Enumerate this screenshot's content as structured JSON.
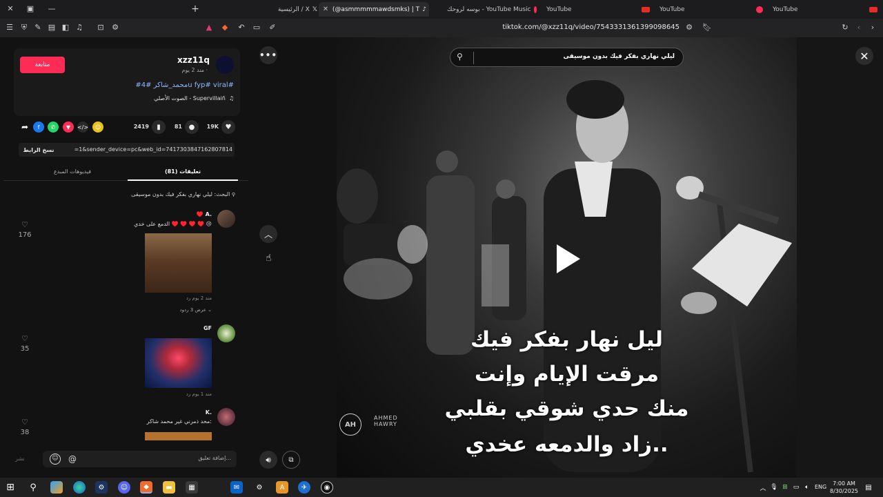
{
  "browser": {
    "tabs": [
      {
        "title": "الرئيسية / X",
        "active": false,
        "icon": "x-logo-icon"
      },
      {
        "title": "(@asmmmmmawdsmks) | TikTok",
        "active": true,
        "icon": "tiktok-icon"
      },
      {
        "title": "بوسه لروحك - YouTube Music",
        "active": false,
        "icon": "youtube-music-icon"
      },
      {
        "title": "YouTube",
        "active": false,
        "icon": "youtube-icon"
      },
      {
        "title": "YouTube",
        "active": false,
        "icon": "youtube-icon"
      },
      {
        "title": "YouTube",
        "active": false,
        "icon": "youtube-icon"
      }
    ],
    "url": "tiktok.com/@xzz11q/video/7543331361399098645"
  },
  "post": {
    "follow_label": "متابعة",
    "username": "xzz11q",
    "time": "مند 2 يوم ·",
    "hashtags": "#محمد_شاكر #4u fyp# viral#",
    "sound": "الصوت الأصلي - Supervillaiñ"
  },
  "stats": {
    "likes": "19K",
    "comments": "81",
    "saves": "2419"
  },
  "share": {
    "copy_label": "نسخ الرابط",
    "link": "=1&sender_device=pc&web_id=7417303847162807814"
  },
  "tabs": {
    "comments": "تعليقات (81)",
    "creator_videos": "فيديوهات المبدع"
  },
  "search_hint": "البحث: ليلي نهاري بفكر فيك بدون موسيقى",
  "comments": [
    {
      "name": "♥️ A.",
      "text": "الدمع على خدي ♥️ ♥️ ♥️ ♥️ 😢",
      "meta": "مند 2 يوم   رد",
      "likes": "176",
      "replies": "عرض 3 ردود ⌄"
    },
    {
      "name": "GF",
      "text": "",
      "meta": "مند 1 يوم   رد",
      "likes": "35",
      "replies": ""
    },
    {
      "name": "K.",
      "text": "محد ذمرني غير محمد شاكر:",
      "meta": "",
      "likes": "38",
      "replies": ""
    }
  ],
  "composer": {
    "placeholder": "إضافة تعليق...",
    "post_label": "نشر"
  },
  "video": {
    "search_query": "ليلي نهاري بفكر فيك بدون موسيقى",
    "lyrics": [
      "ليل نهار بفكر فيك",
      "مرقت الإيام وإنت",
      "منك حدي شوقي بقلبي",
      "زاد والدمعه عخدي.."
    ],
    "watermark": "AHMED HAWRY"
  },
  "taskbar": {
    "language": "ENG",
    "time": "7:00 AM",
    "date": "8/30/2025"
  },
  "colors": {
    "accent": "#fe2c55",
    "hashtag": "#8fb8ff",
    "background": "#121212"
  }
}
